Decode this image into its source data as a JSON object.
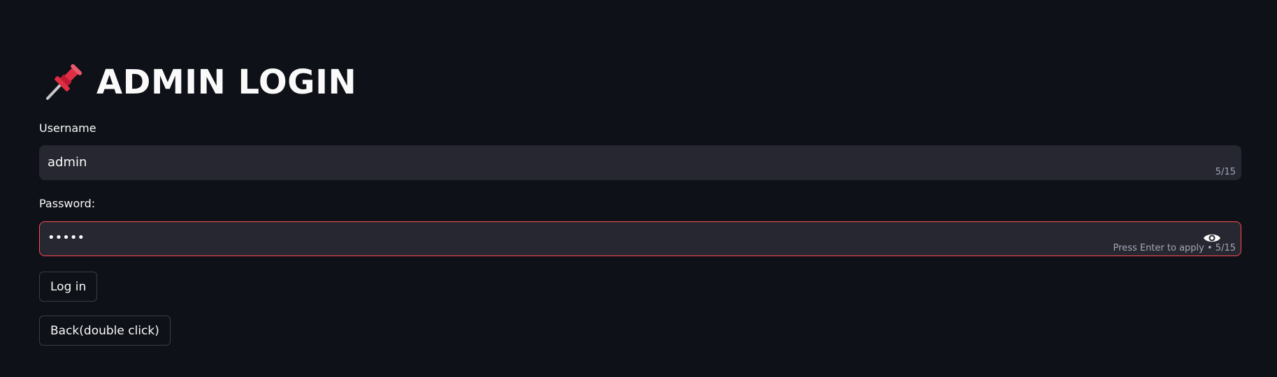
{
  "header": {
    "title": "ADMIN LOGIN",
    "icon": "pushpin-icon"
  },
  "username": {
    "label": "Username",
    "value": "admin",
    "counter": "5/15"
  },
  "password": {
    "label": "Password:",
    "value": "•••••",
    "hint": "Press Enter to apply  •  5/15",
    "icon": "eye-icon"
  },
  "buttons": {
    "login_label": "Log in",
    "back_label": "Back(double click)"
  },
  "colors": {
    "background": "#0e1117",
    "input_bg": "#262730",
    "error_border": "#ff4b4b",
    "text": "#fafafa"
  }
}
